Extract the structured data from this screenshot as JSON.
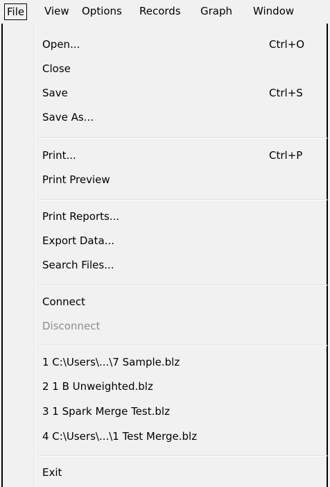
{
  "menubar": {
    "items": [
      {
        "label": "File"
      },
      {
        "label": "View"
      },
      {
        "label": "Options"
      },
      {
        "label": "Records"
      },
      {
        "label": "Graph"
      },
      {
        "label": "Window"
      }
    ]
  },
  "file_menu": {
    "open": {
      "label": "Open...",
      "shortcut": "Ctrl+O"
    },
    "close": {
      "label": "Close"
    },
    "save": {
      "label": "Save",
      "shortcut": "Ctrl+S"
    },
    "save_as": {
      "label": "Save As..."
    },
    "print": {
      "label": "Print...",
      "shortcut": "Ctrl+P"
    },
    "print_preview": {
      "label": "Print Preview"
    },
    "print_reports": {
      "label": "Print Reports..."
    },
    "export_data": {
      "label": "Export Data..."
    },
    "search_files": {
      "label": "Search Files..."
    },
    "connect": {
      "label": "Connect"
    },
    "disconnect": {
      "label": "Disconnect",
      "enabled": false
    },
    "recent_files": [
      {
        "label": "1 C:\\Users\\...\\7 Sample.blz"
      },
      {
        "label": "2 1 B Unweighted.blz"
      },
      {
        "label": "3 1 Spark Merge Test.blz"
      },
      {
        "label": "4 C:\\Users\\...\\1 Test Merge.blz"
      }
    ],
    "exit": {
      "label": "Exit"
    }
  },
  "colors": {
    "menu_background": "#f1f1f1",
    "disabled_text": "#8d8d8d",
    "border": "#000000"
  }
}
